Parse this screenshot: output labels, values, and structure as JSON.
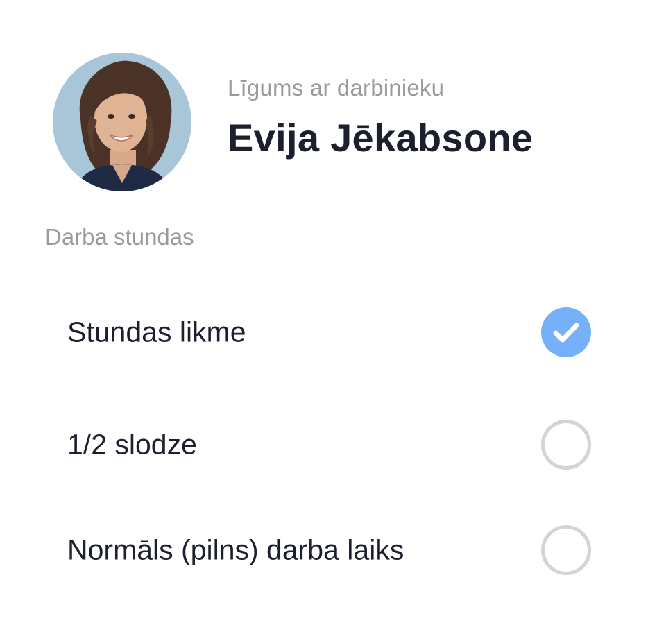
{
  "header": {
    "subtitle": "Līgums ar darbinieku",
    "name": "Evija Jēkabsone",
    "avatar_icon": "person-photo"
  },
  "section": {
    "label": "Darba stundas"
  },
  "options": [
    {
      "label": "Stundas likme",
      "selected": true
    },
    {
      "label": "1/2 slodze",
      "selected": false
    },
    {
      "label": "Normāls (pilns) darba laiks",
      "selected": false
    }
  ],
  "colors": {
    "accent": "#76b0f8",
    "muted_text": "#9a9a9a",
    "primary_text": "#1b1f2e",
    "radio_border": "#d4d4d4"
  }
}
